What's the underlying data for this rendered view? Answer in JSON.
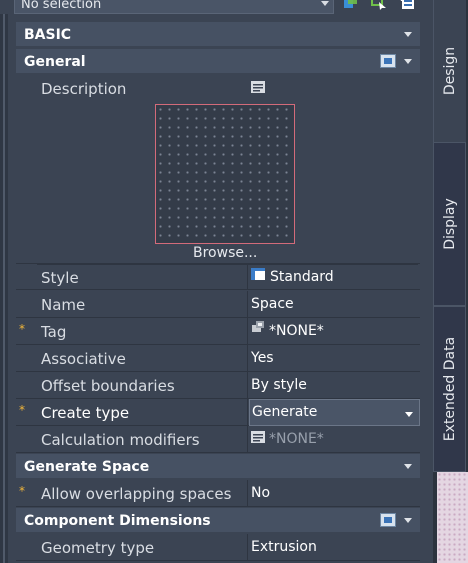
{
  "selector": {
    "value": "No selection"
  },
  "toolbar": {
    "icons": [
      "quick-select-icon",
      "select-objects-icon",
      "toggle-pickadd-icon"
    ]
  },
  "sections": {
    "basic": {
      "label": "BASIC"
    },
    "general": {
      "label": "General"
    },
    "generate_space": {
      "label": "Generate Space"
    },
    "component_dimensions": {
      "label": "Component Dimensions"
    }
  },
  "general": {
    "description": {
      "label": "Description"
    },
    "browse_label": "Browse...",
    "style": {
      "label": "Style",
      "value": "Standard"
    },
    "name": {
      "label": "Name",
      "value": "Space"
    },
    "tag": {
      "label": "Tag",
      "value": "*NONE*",
      "required": "*"
    },
    "associative": {
      "label": "Associative",
      "value": "Yes"
    },
    "offset_boundaries": {
      "label": "Offset boundaries",
      "value": "By style"
    },
    "create_type": {
      "label": "Create type",
      "value": "Generate",
      "required": "*"
    },
    "calculation_modifiers": {
      "label": "Calculation modifiers",
      "value": "*NONE*"
    }
  },
  "generate_space": {
    "allow_overlapping": {
      "label": "Allow overlapping spaces",
      "value": "No",
      "required": "*"
    }
  },
  "component_dimensions": {
    "geometry_type": {
      "label": "Geometry type",
      "value": "Extrusion"
    }
  },
  "tabs": [
    {
      "label": "Design"
    },
    {
      "label": "Display"
    },
    {
      "label": "Extended Data"
    }
  ],
  "colors": {
    "required_star": "#f3b73a",
    "preview_border": "#d36b7a",
    "panel_bg": "#3b4453"
  }
}
